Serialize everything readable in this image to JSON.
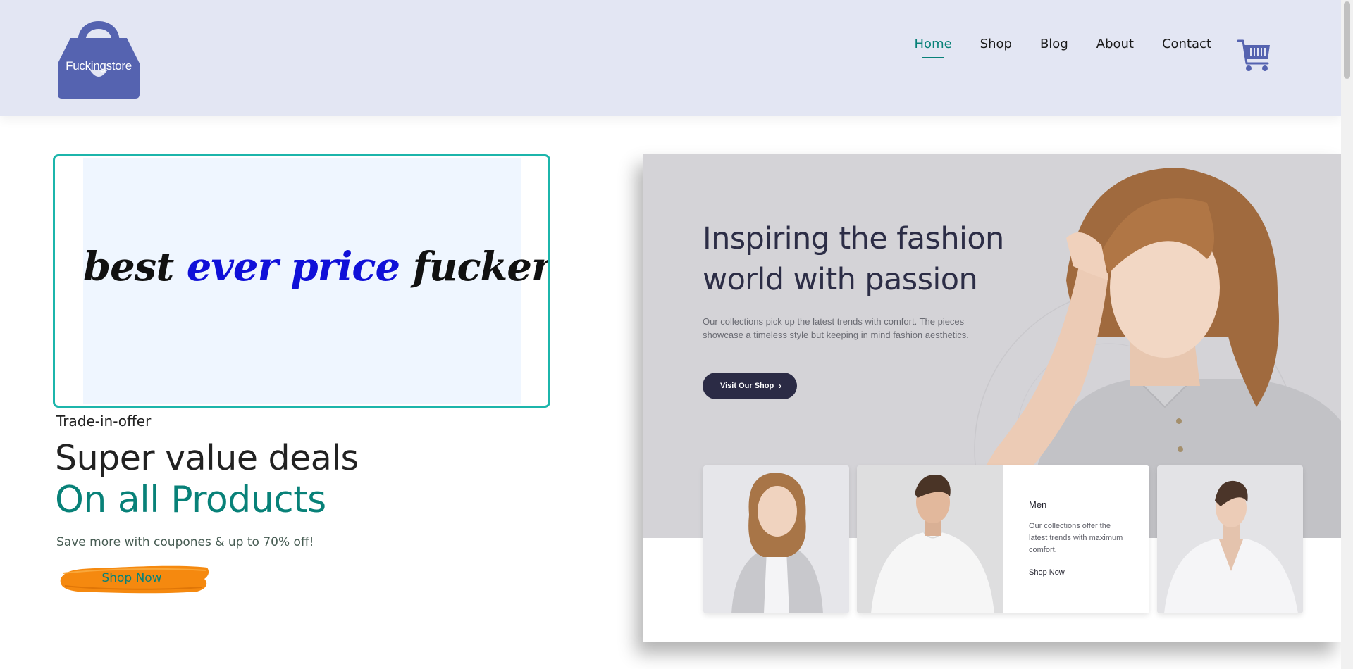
{
  "brand": {
    "name": "Fuckingstore",
    "accent": "#088178",
    "logo_color": "#5563b0"
  },
  "nav": {
    "items": [
      {
        "label": "Home",
        "active": true
      },
      {
        "label": "Shop",
        "active": false
      },
      {
        "label": "Blog",
        "active": false
      },
      {
        "label": "About",
        "active": false
      },
      {
        "label": "Contact",
        "active": false
      }
    ],
    "cart_icon": "shopping-cart-icon"
  },
  "hero": {
    "promo": {
      "word1": "best",
      "word2": "ever price",
      "word3": "fucker"
    },
    "kicker": "Trade-in-offer",
    "headline": "Super value deals",
    "headline_accent": "On all Products",
    "subtext": "Save more with coupones & up to 70% off!",
    "cta": "Shop Now"
  },
  "banner": {
    "title": "Inspiring the fashion world with passion",
    "description": "Our collections pick up the latest trends with comfort. The pieces showcase a timeless style but keeping in mind fashion aesthetics.",
    "button": "Visit Our Shop",
    "men_card": {
      "title": "Men",
      "description": "Our collections offer the latest trends with maximum comfort.",
      "link": "Shop Now"
    }
  }
}
